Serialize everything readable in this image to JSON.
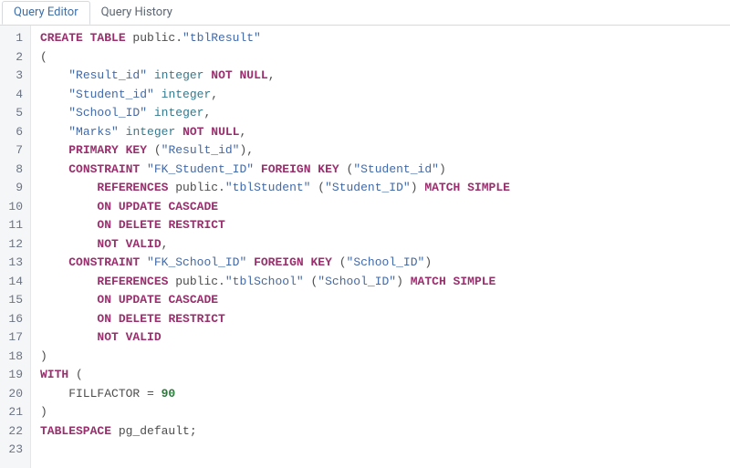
{
  "tabs": {
    "editor_label": "Query Editor",
    "history_label": "Query History",
    "active": "editor"
  },
  "code": {
    "lines": [
      [
        {
          "t": "kw",
          "v": "CREATE TABLE"
        },
        {
          "t": "plain",
          "v": " public."
        },
        {
          "t": "str",
          "v": "\"tblResult\""
        }
      ],
      [
        {
          "t": "plain",
          "v": "("
        }
      ],
      [
        {
          "t": "plain",
          "v": "    "
        },
        {
          "t": "str",
          "v": "\"Result_id\""
        },
        {
          "t": "plain",
          "v": " "
        },
        {
          "t": "builtin",
          "v": "integer"
        },
        {
          "t": "plain",
          "v": " "
        },
        {
          "t": "kw",
          "v": "NOT"
        },
        {
          "t": "plain",
          "v": " "
        },
        {
          "t": "kw-nb",
          "v": "NULL"
        },
        {
          "t": "plain",
          "v": ","
        }
      ],
      [
        {
          "t": "plain",
          "v": "    "
        },
        {
          "t": "str",
          "v": "\"Student_id\""
        },
        {
          "t": "plain",
          "v": " "
        },
        {
          "t": "builtin",
          "v": "integer"
        },
        {
          "t": "plain",
          "v": ","
        }
      ],
      [
        {
          "t": "plain",
          "v": "    "
        },
        {
          "t": "str",
          "v": "\"School_ID\""
        },
        {
          "t": "plain",
          "v": " "
        },
        {
          "t": "builtin",
          "v": "integer"
        },
        {
          "t": "plain",
          "v": ","
        }
      ],
      [
        {
          "t": "plain",
          "v": "    "
        },
        {
          "t": "str",
          "v": "\"Marks\""
        },
        {
          "t": "plain",
          "v": " "
        },
        {
          "t": "builtin",
          "v": "integer"
        },
        {
          "t": "plain",
          "v": " "
        },
        {
          "t": "kw",
          "v": "NOT"
        },
        {
          "t": "plain",
          "v": " "
        },
        {
          "t": "kw-nb",
          "v": "NULL"
        },
        {
          "t": "plain",
          "v": ","
        }
      ],
      [
        {
          "t": "plain",
          "v": "    "
        },
        {
          "t": "kw",
          "v": "PRIMARY KEY"
        },
        {
          "t": "plain",
          "v": " ("
        },
        {
          "t": "str",
          "v": "\"Result_id\""
        },
        {
          "t": "plain",
          "v": "),"
        }
      ],
      [
        {
          "t": "plain",
          "v": "    "
        },
        {
          "t": "kw",
          "v": "CONSTRAINT"
        },
        {
          "t": "plain",
          "v": " "
        },
        {
          "t": "str",
          "v": "\"FK_Student_ID\""
        },
        {
          "t": "plain",
          "v": " "
        },
        {
          "t": "kw",
          "v": "FOREIGN KEY"
        },
        {
          "t": "plain",
          "v": " ("
        },
        {
          "t": "str",
          "v": "\"Student_id\""
        },
        {
          "t": "plain",
          "v": ")"
        }
      ],
      [
        {
          "t": "plain",
          "v": "        "
        },
        {
          "t": "kw",
          "v": "REFERENCES"
        },
        {
          "t": "plain",
          "v": " public."
        },
        {
          "t": "str",
          "v": "\"tblStudent\""
        },
        {
          "t": "plain",
          "v": " ("
        },
        {
          "t": "str",
          "v": "\"Student_ID\""
        },
        {
          "t": "plain",
          "v": ") "
        },
        {
          "t": "kw",
          "v": "MATCH SIMPLE"
        }
      ],
      [
        {
          "t": "plain",
          "v": "        "
        },
        {
          "t": "kw",
          "v": "ON UPDATE"
        },
        {
          "t": "plain",
          "v": " "
        },
        {
          "t": "kw-nb",
          "v": "CASCADE"
        }
      ],
      [
        {
          "t": "plain",
          "v": "        "
        },
        {
          "t": "kw",
          "v": "ON DELETE"
        },
        {
          "t": "plain",
          "v": " "
        },
        {
          "t": "kw-nb",
          "v": "RESTRICT"
        }
      ],
      [
        {
          "t": "plain",
          "v": "        "
        },
        {
          "t": "kw",
          "v": "NOT VALID"
        },
        {
          "t": "plain",
          "v": ","
        }
      ],
      [
        {
          "t": "plain",
          "v": "    "
        },
        {
          "t": "kw",
          "v": "CONSTRAINT"
        },
        {
          "t": "plain",
          "v": " "
        },
        {
          "t": "str",
          "v": "\"FK_School_ID\""
        },
        {
          "t": "plain",
          "v": " "
        },
        {
          "t": "kw",
          "v": "FOREIGN KEY"
        },
        {
          "t": "plain",
          "v": " ("
        },
        {
          "t": "str",
          "v": "\"School_ID\""
        },
        {
          "t": "plain",
          "v": ")"
        }
      ],
      [
        {
          "t": "plain",
          "v": "        "
        },
        {
          "t": "kw",
          "v": "REFERENCES"
        },
        {
          "t": "plain",
          "v": " public."
        },
        {
          "t": "str",
          "v": "\"tblSchool\""
        },
        {
          "t": "plain",
          "v": " ("
        },
        {
          "t": "str",
          "v": "\"School_ID\""
        },
        {
          "t": "plain",
          "v": ") "
        },
        {
          "t": "kw",
          "v": "MATCH SIMPLE"
        }
      ],
      [
        {
          "t": "plain",
          "v": "        "
        },
        {
          "t": "kw",
          "v": "ON UPDATE"
        },
        {
          "t": "plain",
          "v": " "
        },
        {
          "t": "kw-nb",
          "v": "CASCADE"
        }
      ],
      [
        {
          "t": "plain",
          "v": "        "
        },
        {
          "t": "kw",
          "v": "ON DELETE"
        },
        {
          "t": "plain",
          "v": " "
        },
        {
          "t": "kw-nb",
          "v": "RESTRICT"
        }
      ],
      [
        {
          "t": "plain",
          "v": "        "
        },
        {
          "t": "kw",
          "v": "NOT VALID"
        }
      ],
      [
        {
          "t": "plain",
          "v": ")"
        }
      ],
      [
        {
          "t": "kw",
          "v": "WITH"
        },
        {
          "t": "plain",
          "v": " ("
        }
      ],
      [
        {
          "t": "plain",
          "v": "    FILLFACTOR = "
        },
        {
          "t": "num",
          "v": "90"
        }
      ],
      [
        {
          "t": "plain",
          "v": ")"
        }
      ],
      [
        {
          "t": "kw",
          "v": "TABLESPACE"
        },
        {
          "t": "plain",
          "v": " pg_default;"
        }
      ],
      []
    ]
  }
}
